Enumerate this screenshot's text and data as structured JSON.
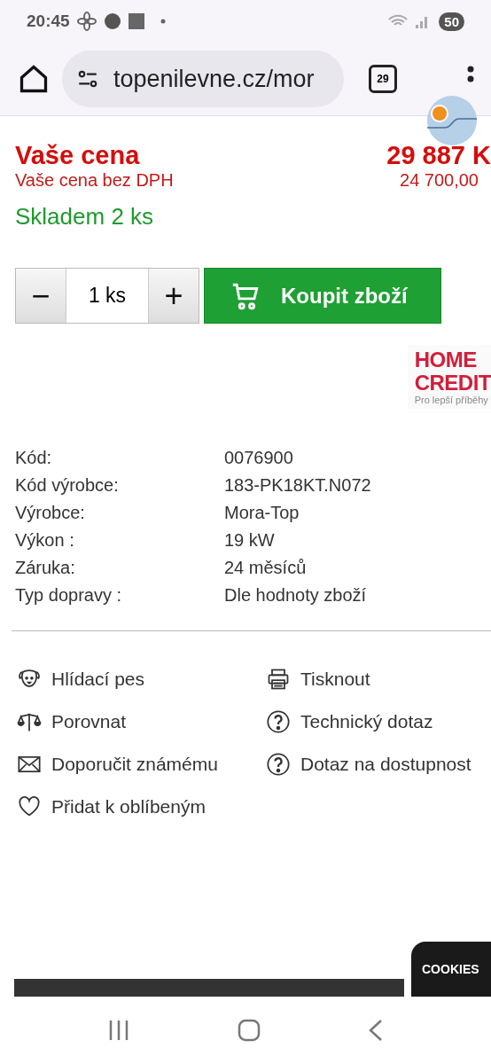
{
  "status_bar": {
    "time": "20:45",
    "battery": "50"
  },
  "browser": {
    "url": "topenilevne.cz/mor",
    "tab_count": "29"
  },
  "price": {
    "label": "Vaše cena",
    "value": "29 887 K",
    "net_label": "Vaše cena bez DPH",
    "net_value": "24 700,00"
  },
  "stock": "Skladem 2 ks",
  "quantity": {
    "minus": "−",
    "value": "1 ks",
    "plus": "+"
  },
  "buy_button": "Koupit zboží",
  "financing_logo": {
    "line_1": "HOME",
    "line_2": "CREDIT",
    "tagline": "Pro lepší příběhy"
  },
  "specs": [
    {
      "label": "Kód:",
      "value": "0076900"
    },
    {
      "label": "Kód výrobce:",
      "value": "183-PK18KT.N072"
    },
    {
      "label": "Výrobce:",
      "value": "Mora-Top"
    },
    {
      "label": "Výkon :",
      "value": "19 kW"
    },
    {
      "label": "Záruka:",
      "value": "24 měsíců"
    },
    {
      "label": "Typ dopravy :",
      "value": "Dle hodnoty zboží"
    }
  ],
  "actions": [
    {
      "kind": "dog",
      "label": "Hlídací pes"
    },
    {
      "kind": "print",
      "label": "Tisknout"
    },
    {
      "kind": "scales",
      "label": "Porovnat"
    },
    {
      "kind": "question",
      "label": "Technický dotaz"
    },
    {
      "kind": "mail",
      "label": "Doporučit známému"
    },
    {
      "kind": "question",
      "label": "Dotaz na dostupnost"
    },
    {
      "kind": "heart",
      "label": "Přidat k oblíbeným"
    }
  ],
  "cookies_tab": "COOKIES"
}
